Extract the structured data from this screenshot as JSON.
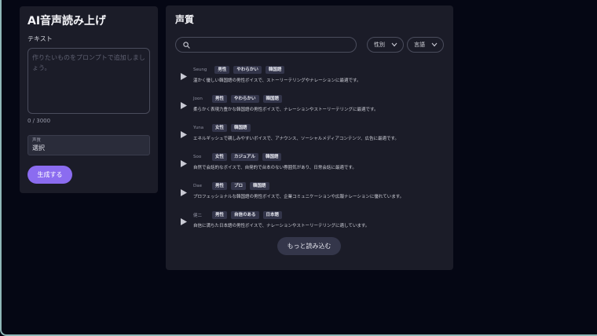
{
  "left_panel": {
    "title": "AI音声読み上げ",
    "text_label": "テキスト",
    "prompt_placeholder": "作りたいものをプロンプトで追加しましょう。",
    "prompt_value": "",
    "char_counter": "0 / 3000",
    "voice_select": {
      "label": "声質",
      "value": "選択"
    },
    "generate_label": "生成する"
  },
  "right_panel": {
    "title": "声質",
    "search": {
      "placeholder": "",
      "value": ""
    },
    "gender_filter": "性別",
    "language_filter": "言語",
    "voices": [
      {
        "name": "Seung",
        "tags": [
          "男性",
          "やわらかい",
          "韓国語"
        ],
        "description": "温かく優しい韓国語の男性ボイスで、ストーリーテリングやナレーションに最適です。"
      },
      {
        "name": "Joon",
        "tags": [
          "男性",
          "やわらかい",
          "韓国語"
        ],
        "description": "柔らかく表現力豊かな韓国語の男性ボイスで、ナレーションやストーリーテリングに最適です。"
      },
      {
        "name": "Yuna",
        "tags": [
          "女性",
          "韓国語"
        ],
        "description": "エネルギッシュで親しみやすいボイスで、アナウンス、ソーシャルメディアコンテンツ、広告に最適です。"
      },
      {
        "name": "Soo",
        "tags": [
          "女性",
          "カジュアル",
          "韓国語"
        ],
        "description": "自然で会話的なボイスで、自発的で台本のない雰囲気があり、日常会話に最適です。"
      },
      {
        "name": "Dae",
        "tags": [
          "男性",
          "プロ",
          "韓国語"
        ],
        "description": "プロフェッショナルな韓国語の男性ボイスで、企業コミュニケーションや広報ナレーションに優れています。"
      },
      {
        "name": "健二",
        "tags": [
          "男性",
          "自信のある",
          "日本語"
        ],
        "description": "自信に満ちた日本語の男性ボイスで、ナレーションやストーリーテリングに適しています。"
      }
    ],
    "load_more_label": "もっと読み込む"
  },
  "colors": {
    "background": "#050714",
    "panel": "#1b1c28",
    "accent": "#8b6cf0",
    "tag_bg": "#33354a"
  }
}
